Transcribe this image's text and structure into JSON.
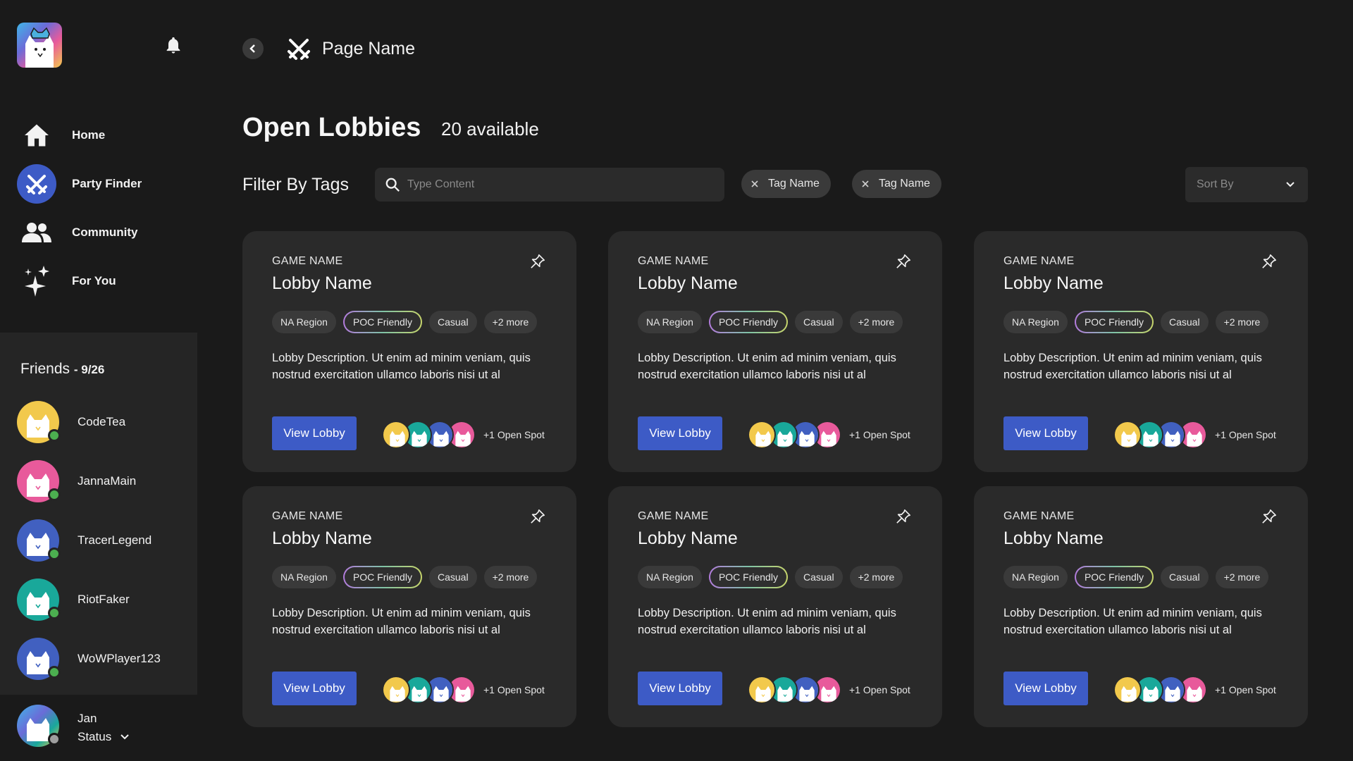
{
  "colors": {
    "accent": "#3d5bc6",
    "online": "#4caf50",
    "offline": "#9e9e9e",
    "card_bg": "#2a2a2a"
  },
  "sidebar": {
    "nav": [
      {
        "label": "Home",
        "icon": "home-icon"
      },
      {
        "label": "Party Finder",
        "icon": "swords-icon",
        "active": true
      },
      {
        "label": "Community",
        "icon": "people-icon"
      },
      {
        "label": "For You",
        "icon": "sparkles-icon"
      }
    ],
    "friends": {
      "title": "Friends",
      "count": "- 9/26",
      "list": [
        {
          "name": "CodeTea",
          "color": "#f2c94c",
          "status": "online"
        },
        {
          "name": "JannaMain",
          "color": "#e85a9b",
          "status": "online"
        },
        {
          "name": "TracerLegend",
          "color": "#4160c0",
          "status": "online"
        },
        {
          "name": "RiotFaker",
          "color": "#19a89a",
          "status": "online"
        },
        {
          "name": "WoWPlayer123",
          "color": "#4160c0",
          "status": "online"
        }
      ]
    },
    "user": {
      "name": "Jan",
      "status": "Status"
    }
  },
  "header": {
    "page_name": "Page Name"
  },
  "main": {
    "title": "Open Lobbies",
    "available": "20 available",
    "filter_label": "Filter By Tags",
    "search_placeholder": "Type Content",
    "chips": [
      "Tag Name",
      "Tag Name"
    ],
    "sort_label": "Sort By"
  },
  "cards": [
    {
      "game": "GAME NAME",
      "lobby": "Lobby Name",
      "tags": [
        "NA Region",
        "POC Friendly",
        "Casual",
        "+2 more"
      ],
      "description": "Lobby Description. Ut enim ad minim veniam, quis nostrud exercitation ullamco laboris nisi ut al",
      "button": "View Lobby",
      "spots": "+1 Open Spot"
    },
    {
      "game": "GAME NAME",
      "lobby": "Lobby Name",
      "tags": [
        "NA Region",
        "POC Friendly",
        "Casual",
        "+2 more"
      ],
      "description": "Lobby Description. Ut enim ad minim veniam, quis nostrud exercitation ullamco laboris nisi ut al",
      "button": "View Lobby",
      "spots": "+1 Open Spot"
    },
    {
      "game": "GAME NAME",
      "lobby": "Lobby Name",
      "tags": [
        "NA Region",
        "POC Friendly",
        "Casual",
        "+2 more"
      ],
      "description": "Lobby Description. Ut enim ad minim veniam, quis nostrud exercitation ullamco laboris nisi ut al",
      "button": "View Lobby",
      "spots": "+1 Open Spot"
    },
    {
      "game": "GAME NAME",
      "lobby": "Lobby Name",
      "tags": [
        "NA Region",
        "POC Friendly",
        "Casual",
        "+2 more"
      ],
      "description": "Lobby Description. Ut enim ad minim veniam, quis nostrud exercitation ullamco laboris nisi ut al",
      "button": "View Lobby",
      "spots": "+1 Open Spot"
    },
    {
      "game": "GAME NAME",
      "lobby": "Lobby Name",
      "tags": [
        "NA Region",
        "POC Friendly",
        "Casual",
        "+2 more"
      ],
      "description": "Lobby Description. Ut enim ad minim veniam, quis nostrud exercitation ullamco laboris nisi ut al",
      "button": "View Lobby",
      "spots": "+1 Open Spot"
    },
    {
      "game": "GAME NAME",
      "lobby": "Lobby Name",
      "tags": [
        "NA Region",
        "POC Friendly",
        "Casual",
        "+2 more"
      ],
      "description": "Lobby Description. Ut enim ad minim veniam, quis nostrud exercitation ullamco laboris nisi ut al",
      "button": "View Lobby",
      "spots": "+1 Open Spot"
    }
  ],
  "member_colors": [
    "#f2c94c",
    "#19a89a",
    "#4160c0",
    "#e85a9b"
  ]
}
